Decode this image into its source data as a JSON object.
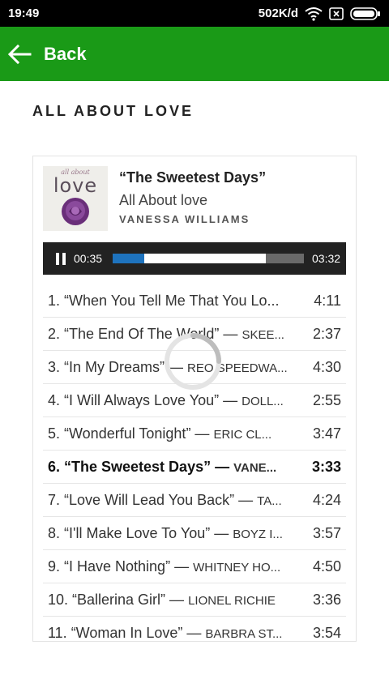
{
  "status_bar": {
    "time": "19:49",
    "network_speed": "502K/d",
    "icons": [
      "wifi-icon",
      "sim-icon",
      "battery-icon"
    ]
  },
  "app_bar": {
    "back_label": "Back",
    "color": "#1a9a17",
    "back_icon": "arrow-left-icon"
  },
  "page": {
    "title": "ALL ABOUT LOVE"
  },
  "now_playing": {
    "cover": {
      "small_text": "all about",
      "big_text": "love"
    },
    "title": "“The Sweetest Days”",
    "album": "All About love",
    "artist": "VANESSA WILLIAMS"
  },
  "player": {
    "state": "playing",
    "current_time": "00:35",
    "duration": "03:32",
    "progress_fraction": 0.165,
    "buffered_fraction": 0.8,
    "progress_color": "#1e73be"
  },
  "playlist": [
    {
      "name": "1. “When You Tell Me That You Lo...",
      "artist": "",
      "duration": "4:11",
      "active": false
    },
    {
      "name": "2. “The End Of The World” — ",
      "artist": "SKEE...",
      "duration": "2:37",
      "active": false
    },
    {
      "name": "3. “In My Dreams” — ",
      "artist": "REO SPEEDWA...",
      "duration": "4:30",
      "active": false
    },
    {
      "name": "4. “I Will Always Love You” — ",
      "artist": "DOLL...",
      "duration": "2:55",
      "active": false
    },
    {
      "name": "5. “Wonderful Tonight” — ",
      "artist": "ERIC CL...",
      "duration": "3:47",
      "active": false
    },
    {
      "name": "6. “The Sweetest Days” — ",
      "artist": "VANE...",
      "duration": "3:33",
      "active": true
    },
    {
      "name": "7. “Love Will Lead You Back” — ",
      "artist": "TA...",
      "duration": "4:24",
      "active": false
    },
    {
      "name": "8. “I'll Make Love To You” — ",
      "artist": "BOYZ I...",
      "duration": "3:57",
      "active": false
    },
    {
      "name": "9. “I Have Nothing” — ",
      "artist": "WHITNEY HO...",
      "duration": "4:50",
      "active": false
    },
    {
      "name": "10. “Ballerina Girl” — ",
      "artist": "LIONEL RICHIE",
      "duration": "3:36",
      "active": false
    },
    {
      "name": "11. “Woman In Love” — ",
      "artist": "BARBRA ST...",
      "duration": "3:54",
      "active": false
    }
  ]
}
